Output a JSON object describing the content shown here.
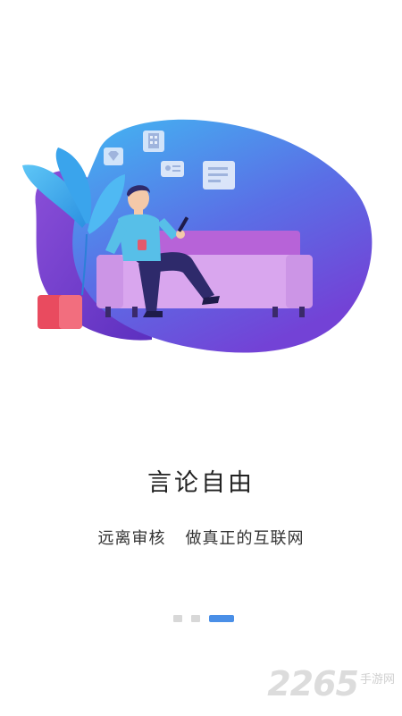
{
  "slide": {
    "title": "言论自由",
    "subtitle_part1": "远离审核",
    "subtitle_part2": "做真正的互联网"
  },
  "pager": {
    "count": 3,
    "active_index": 2
  },
  "watermark": {
    "number": "2265",
    "text": "手游网"
  },
  "colors": {
    "accent": "#4a8fe7",
    "blob_top": "#3fb2f0",
    "blob_bottom": "#6a3fd6",
    "sofa": "#c889e6"
  }
}
